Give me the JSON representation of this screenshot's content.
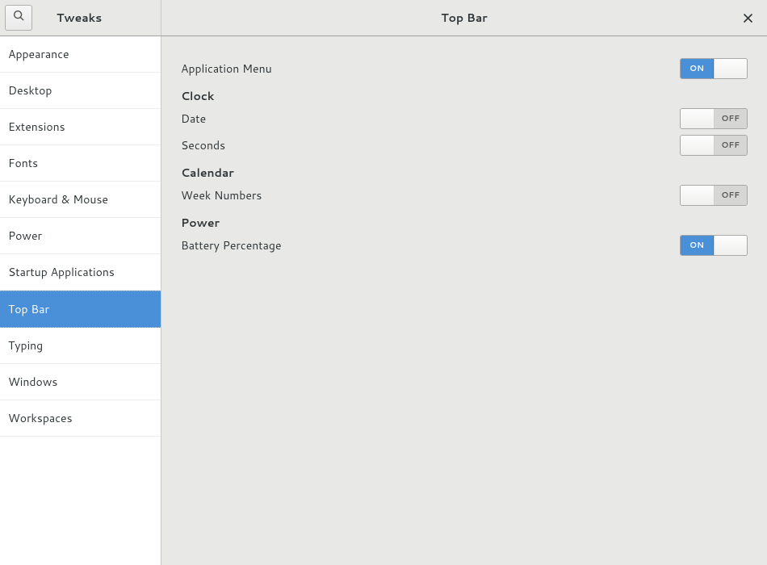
{
  "app_title": "Tweaks",
  "panel_title": "Top Bar",
  "on_text": "ON",
  "off_text": "OFF",
  "sidebar": {
    "items": [
      {
        "id": "appearance",
        "label": "Appearance"
      },
      {
        "id": "desktop",
        "label": "Desktop"
      },
      {
        "id": "extensions",
        "label": "Extensions"
      },
      {
        "id": "fonts",
        "label": "Fonts"
      },
      {
        "id": "keyboard-mouse",
        "label": "Keyboard & Mouse"
      },
      {
        "id": "power",
        "label": "Power"
      },
      {
        "id": "startup-applications",
        "label": "Startup Applications"
      },
      {
        "id": "top-bar",
        "label": "Top Bar"
      },
      {
        "id": "typing",
        "label": "Typing"
      },
      {
        "id": "windows",
        "label": "Windows"
      },
      {
        "id": "workspaces",
        "label": "Workspaces"
      }
    ],
    "active": "top-bar"
  },
  "settings": {
    "application_menu": {
      "label": "Application Menu",
      "value": true
    },
    "clock_header": "Clock",
    "date": {
      "label": "Date",
      "value": false
    },
    "seconds": {
      "label": "Seconds",
      "value": false
    },
    "calendar_header": "Calendar",
    "week_numbers": {
      "label": "Week Numbers",
      "value": false
    },
    "power_header": "Power",
    "battery_percentage": {
      "label": "Battery Percentage",
      "value": true
    }
  }
}
